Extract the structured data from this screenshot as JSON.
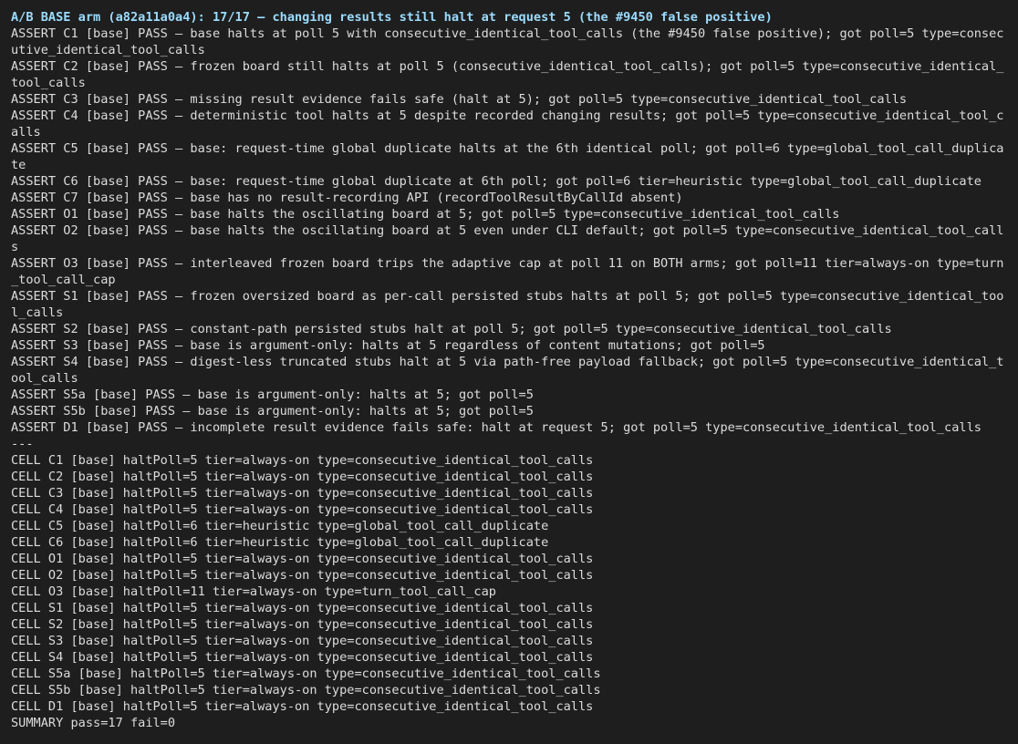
{
  "header": {
    "text": "A/B BASE arm (a82a11a0a4): 17/17 — changing results still halt at request 5 (the #9450 false positive)"
  },
  "lines": [
    "ASSERT C1 [base] PASS — base halts at poll 5 with consecutive_identical_tool_calls (the #9450 false positive); got poll=5 type=consecutive_identical_tool_calls",
    "ASSERT C2 [base] PASS — frozen board still halts at poll 5 (consecutive_identical_tool_calls); got poll=5 type=consecutive_identical_tool_calls",
    "ASSERT C3 [base] PASS — missing result evidence fails safe (halt at 5); got poll=5 type=consecutive_identical_tool_calls",
    "ASSERT C4 [base] PASS — deterministic tool halts at 5 despite recorded changing results; got poll=5 type=consecutive_identical_tool_calls",
    "ASSERT C5 [base] PASS — base: request-time global duplicate halts at the 6th identical poll; got poll=6 type=global_tool_call_duplicate",
    "ASSERT C6 [base] PASS — base: request-time global duplicate at 6th poll; got poll=6 tier=heuristic type=global_tool_call_duplicate",
    "ASSERT C7 [base] PASS — base has no result-recording API (recordToolResultByCallId absent)",
    "ASSERT O1 [base] PASS — base halts the oscillating board at 5; got poll=5 type=consecutive_identical_tool_calls",
    "ASSERT O2 [base] PASS — base halts the oscillating board at 5 even under CLI default; got poll=5 type=consecutive_identical_tool_calls",
    "ASSERT O3 [base] PASS — interleaved frozen board trips the adaptive cap at poll 11 on BOTH arms; got poll=11 tier=always-on type=turn_tool_call_cap",
    "ASSERT S1 [base] PASS — frozen oversized board as per-call persisted stubs halts at poll 5; got poll=5 type=consecutive_identical_tool_calls",
    "ASSERT S2 [base] PASS — constant-path persisted stubs halt at poll 5; got poll=5 type=consecutive_identical_tool_calls",
    "ASSERT S3 [base] PASS — base is argument-only: halts at 5 regardless of content mutations; got poll=5",
    "ASSERT S4 [base] PASS — digest-less truncated stubs halt at 5 via path-free payload fallback; got poll=5 type=consecutive_identical_tool_calls",
    "ASSERT S5a [base] PASS — base is argument-only: halts at 5; got poll=5",
    "ASSERT S5b [base] PASS — base is argument-only: halts at 5; got poll=5",
    "ASSERT D1 [base] PASS — incomplete result evidence fails safe: halt at request 5; got poll=5 type=consecutive_identical_tool_calls",
    "---",
    "CELL C1 [base] haltPoll=5 tier=always-on type=consecutive_identical_tool_calls",
    "CELL C2 [base] haltPoll=5 tier=always-on type=consecutive_identical_tool_calls",
    "CELL C3 [base] haltPoll=5 tier=always-on type=consecutive_identical_tool_calls",
    "CELL C4 [base] haltPoll=5 tier=always-on type=consecutive_identical_tool_calls",
    "CELL C5 [base] haltPoll=6 tier=heuristic type=global_tool_call_duplicate",
    "CELL C6 [base] haltPoll=6 tier=heuristic type=global_tool_call_duplicate",
    "CELL O1 [base] haltPoll=5 tier=always-on type=consecutive_identical_tool_calls",
    "CELL O2 [base] haltPoll=5 tier=always-on type=consecutive_identical_tool_calls",
    "CELL O3 [base] haltPoll=11 tier=always-on type=turn_tool_call_cap",
    "CELL S1 [base] haltPoll=5 tier=always-on type=consecutive_identical_tool_calls",
    "CELL S2 [base] haltPoll=5 tier=always-on type=consecutive_identical_tool_calls",
    "CELL S3 [base] haltPoll=5 tier=always-on type=consecutive_identical_tool_calls",
    "CELL S4 [base] haltPoll=5 tier=always-on type=consecutive_identical_tool_calls",
    "CELL S5a [base] haltPoll=5 tier=always-on type=consecutive_identical_tool_calls",
    "CELL S5b [base] haltPoll=5 tier=always-on type=consecutive_identical_tool_calls",
    "CELL D1 [base] haltPoll=5 tier=always-on type=consecutive_identical_tool_calls",
    "SUMMARY pass=17 fail=0"
  ]
}
